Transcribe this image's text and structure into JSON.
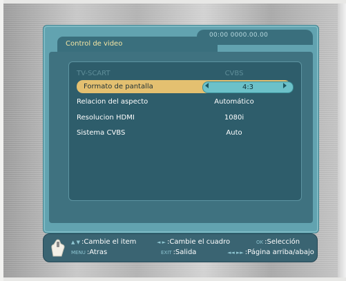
{
  "window": {
    "title": "Control de video",
    "clock": "00:00  0000.00.00"
  },
  "menu": {
    "rows": [
      {
        "label": "TV-SCART",
        "value": "CVBS",
        "state": "disabled"
      },
      {
        "label": "Formato de pantalla",
        "value": "4:3",
        "state": "selected"
      },
      {
        "label": "Relacion del aspecto",
        "value": "Automático",
        "state": "normal"
      },
      {
        "label": "Resolucion HDMI",
        "value": "1080i",
        "state": "normal"
      },
      {
        "label": "Sistema CVBS",
        "value": "Auto",
        "state": "normal"
      }
    ]
  },
  "help": {
    "item_change": {
      "keys": "▲ ▼",
      "text": ":Cambie el item"
    },
    "frame_change": {
      "keys": "◄ ►",
      "text": ":Cambie el cuadro"
    },
    "selection": {
      "keys": "OK",
      "text": ":Selección"
    },
    "menu_back": {
      "keys": "MENU",
      "text": ":Atras"
    },
    "exit": {
      "keys": "EXIT",
      "text": ":Salida"
    },
    "page": {
      "keys": "◄◄ ►►",
      "text": ":Página arriba/abajo"
    }
  },
  "colors": {
    "window": "#62a3b0",
    "panel": "#2e5d6b",
    "highlight": "#e4c070",
    "value_box": "#6cc1c9",
    "title_text": "#f3e5a4"
  }
}
